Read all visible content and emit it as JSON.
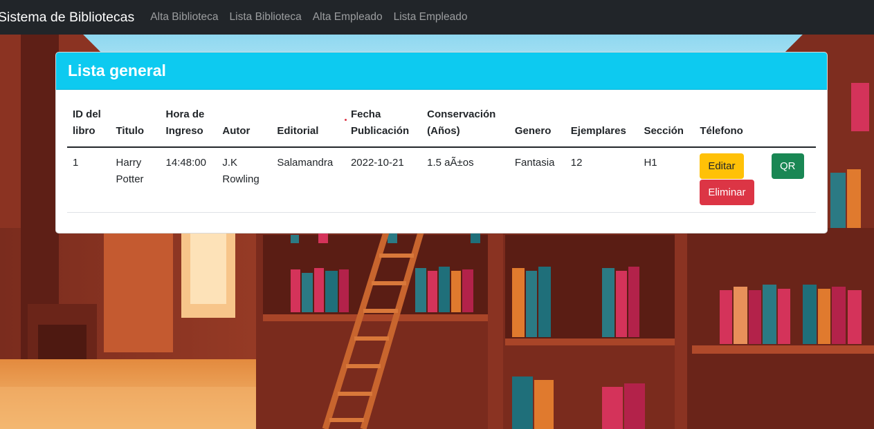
{
  "navbar": {
    "brand": "Sistema de Bibliotecas",
    "links": [
      "Alta Biblioteca",
      "Lista Biblioteca",
      "Alta Empleado",
      "Lista Empleado"
    ]
  },
  "card": {
    "title": "Lista general"
  },
  "table": {
    "headers": [
      [
        "ID del",
        "libro"
      ],
      [
        "Titulo"
      ],
      [
        "Hora de",
        "Ingreso"
      ],
      [
        "Autor"
      ],
      [
        "Editorial"
      ],
      [
        "Fecha",
        "Publicación"
      ],
      [
        "Conservación",
        "(Años)"
      ],
      [
        "Genero"
      ],
      [
        "Ejemplares"
      ],
      [
        "Sección"
      ],
      [
        "Télefono"
      ],
      [
        ""
      ]
    ],
    "rows": [
      {
        "id": "1",
        "titulo": "Harry Potter",
        "hora": "14:48:00",
        "autor": "J.K Rowling",
        "editorial": "Salamandra",
        "fecha": "2022-10-21",
        "conservacion": "1.5 aÃ±os",
        "genero": "Fantasia",
        "ejemplares": "12",
        "seccion": "H1",
        "edit_label": "Editar",
        "delete_label": "Eliminar",
        "qr_label": "QR"
      }
    ]
  },
  "colors": {
    "navbar": "#212529",
    "header": "#0dcaf0",
    "edit": "#ffc107",
    "delete": "#dc3545",
    "qr": "#198754"
  }
}
